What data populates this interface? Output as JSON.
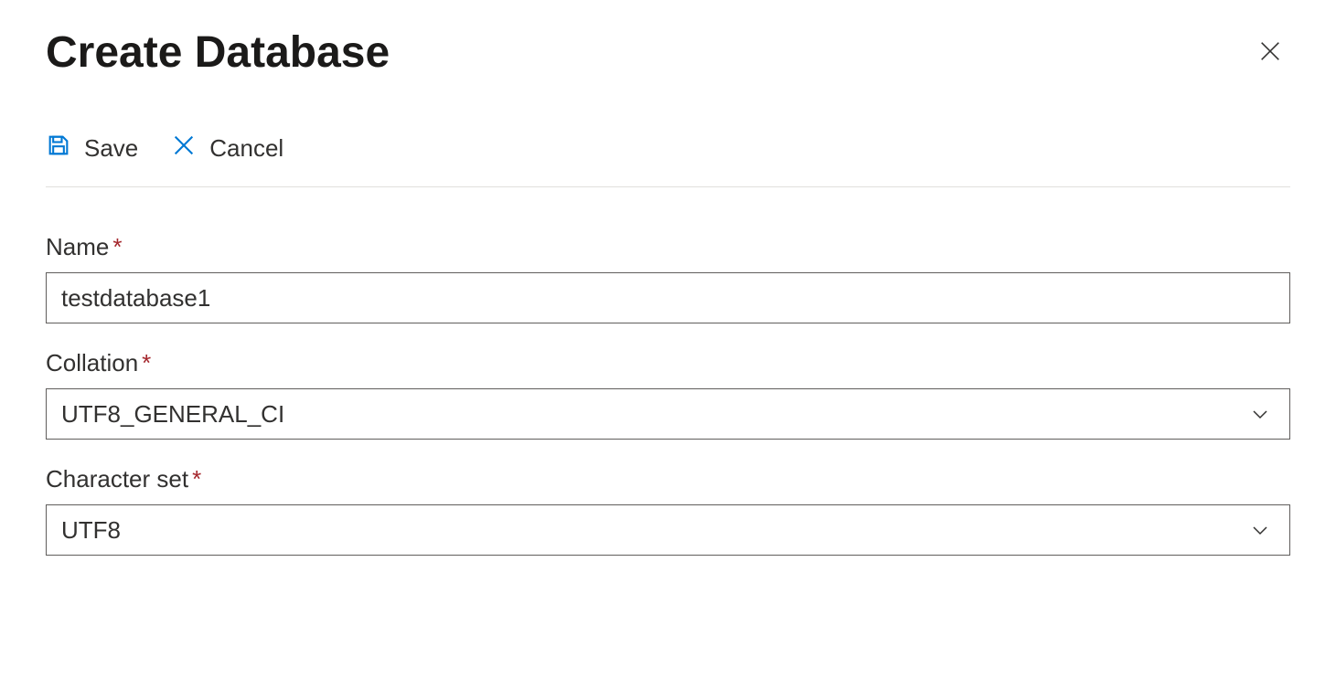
{
  "header": {
    "title": "Create Database"
  },
  "toolbar": {
    "save_label": "Save",
    "cancel_label": "Cancel"
  },
  "form": {
    "name": {
      "label": "Name",
      "value": "testdatabase1"
    },
    "collation": {
      "label": "Collation",
      "value": "UTF8_GENERAL_CI"
    },
    "charset": {
      "label": "Character set",
      "value": "UTF8"
    }
  }
}
